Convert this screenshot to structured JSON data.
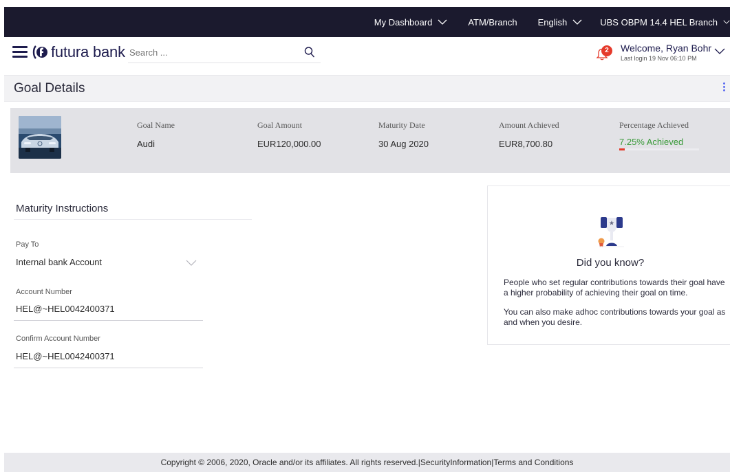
{
  "topbar": {
    "dashboard": "My Dashboard",
    "atm": "ATM/Branch",
    "language": "English",
    "branch": "UBS OBPM 14.4 HEL Branch"
  },
  "header": {
    "logo_text": "futura bank",
    "search_placeholder": "Search ...",
    "notification_count": "2",
    "welcome": "Welcome, Ryan Bohr",
    "last_login": "Last login 19 Nov 06:10 PM"
  },
  "page": {
    "title": "Goal Details"
  },
  "goal": {
    "name_label": "Goal Name",
    "name": "Audi",
    "amount_label": "Goal Amount",
    "amount": "EUR120,000.00",
    "maturity_label": "Maturity Date",
    "maturity": "30 Aug 2020",
    "achieved_label": "Amount Achieved",
    "achieved": "EUR8,700.80",
    "percent_label": "Percentage Achieved",
    "percent_text": "7.25% Achieved",
    "percent_value": 7.25
  },
  "maturity": {
    "title": "Maturity Instructions",
    "pay_to_label": "Pay To",
    "pay_to": "Internal bank Account",
    "account_label": "Account Number",
    "account": "HEL@~HEL0042400371",
    "confirm_label": "Confirm Account Number",
    "confirm": "HEL@~HEL0042400371"
  },
  "did_you_know": {
    "title": "Did you know?",
    "para1": "People who set regular contributions towards their goal have a higher probability of achieving their goal on time.",
    "para2": "You can also make adhoc contributions towards your goal as and when you desire."
  },
  "footer": {
    "copyright": "Copyright © 2006, 2020, Oracle and/or its affiliates. All rights reserved.",
    "separator": "|",
    "security": "SecurityInformation",
    "terms": "Terms and Conditions"
  },
  "colors": {
    "topbar_bg": "#1b1a2e",
    "brand": "#1e1c4e",
    "progress_fill": "#e33b2d",
    "achieved_text": "#3a9a3a",
    "badge": "#e53a2b"
  }
}
